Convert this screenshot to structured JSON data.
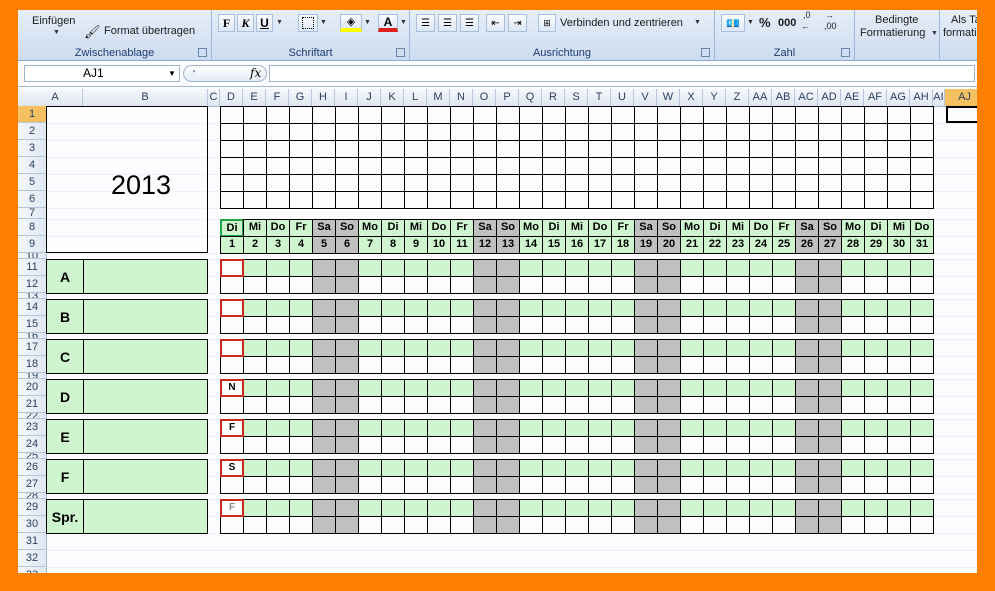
{
  "ribbon": {
    "clipboard": {
      "paste_label": "Einfügen",
      "format_painter_label": "Format übertragen",
      "group_label": "Zwischenablage"
    },
    "font": {
      "bold_label": "F",
      "italic_label": "K",
      "underline_label": "U",
      "font_color_label": "A",
      "group_label": "Schriftart"
    },
    "alignment": {
      "merge_label": "Verbinden und zentrieren",
      "group_label": "Ausrichtung"
    },
    "number": {
      "percent_label": "%",
      "thousands_label": "000",
      "inc_decimal_label": ",0",
      "dec_decimal_label": ",00",
      "group_label": "Zahl"
    },
    "styles": {
      "conditional_label_1": "Bedingte",
      "conditional_label_2": "Formatierung",
      "as_table_label_1": "Als Ta",
      "as_table_label_2": "formati"
    }
  },
  "formula_bar": {
    "name_box_value": "AJ1",
    "fx_label": "fx",
    "formula_value": ""
  },
  "columns": [
    "A",
    "B",
    "C",
    "D",
    "E",
    "F",
    "G",
    "H",
    "I",
    "J",
    "K",
    "L",
    "M",
    "N",
    "O",
    "P",
    "Q",
    "R",
    "S",
    "T",
    "U",
    "V",
    "W",
    "X",
    "Y",
    "Z",
    "AA",
    "AB",
    "AC",
    "AD",
    "AE",
    "AF",
    "AG",
    "AH",
    "AI",
    "AJ"
  ],
  "rows": [
    "1",
    "2",
    "3",
    "4",
    "5",
    "6",
    "7",
    "8",
    "9",
    "10",
    "11",
    "12",
    "13",
    "14",
    "15",
    "16",
    "17",
    "18",
    "19",
    "20",
    "21",
    "22",
    "23",
    "24",
    "25",
    "26",
    "27",
    "28",
    "29",
    "30",
    "31",
    "32",
    "33"
  ],
  "calendar": {
    "year": "2013",
    "day_names": [
      "Di",
      "Mi",
      "Do",
      "Fr",
      "Sa",
      "So",
      "Mo",
      "Di",
      "Mi",
      "Do",
      "Fr",
      "Sa",
      "So",
      "Mo",
      "Di",
      "Mi",
      "Do",
      "Fr",
      "Sa",
      "So",
      "Mo",
      "Di",
      "Mi",
      "Do",
      "Fr",
      "Sa",
      "So",
      "Mo",
      "Di",
      "Mi",
      "Do"
    ],
    "day_numbers": [
      "1",
      "2",
      "3",
      "4",
      "5",
      "6",
      "7",
      "8",
      "9",
      "10",
      "11",
      "12",
      "13",
      "14",
      "15",
      "16",
      "17",
      "18",
      "19",
      "20",
      "21",
      "22",
      "23",
      "24",
      "25",
      "26",
      "27",
      "28",
      "29",
      "30",
      "31"
    ],
    "weekend_days": [
      5,
      6,
      12,
      13,
      19,
      20,
      26,
      27
    ],
    "groups": [
      {
        "label": "A",
        "marker": ""
      },
      {
        "label": "B",
        "marker": ""
      },
      {
        "label": "C",
        "marker": ""
      },
      {
        "label": "D",
        "marker": "N"
      },
      {
        "label": "E",
        "marker": "F"
      },
      {
        "label": "F",
        "marker": "S"
      },
      {
        "label": "Spr.",
        "marker": "F"
      }
    ]
  },
  "colors": {
    "frame": "#ff7f00",
    "green": "#cff5cf",
    "weekend": "#c0c0c0",
    "marker_border": "#c9281c"
  }
}
